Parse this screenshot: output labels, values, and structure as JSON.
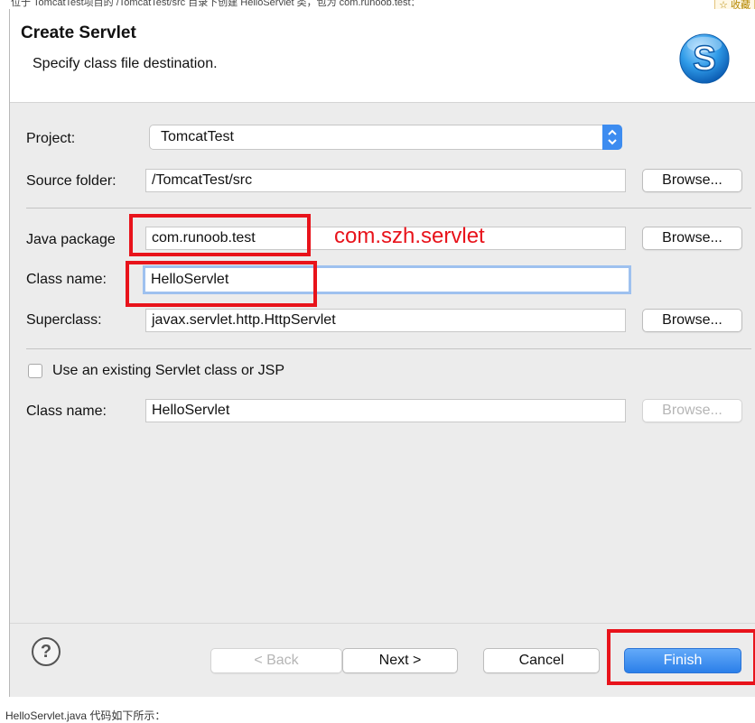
{
  "page": {
    "top_text": "位于 TomcatTest项目的 /TomcatTest/src 目录下创建 HelloServlet 类，包为 com.runoob.test：",
    "top_badge": "☆ 收藏",
    "footer_text": "HelloServlet.java 代码如下所示："
  },
  "dialog": {
    "title": "Create Servlet",
    "subtitle": "Specify class file destination.",
    "logo_icon": "servlet-s-logo-icon"
  },
  "form": {
    "project_label": "Project:",
    "project_value": "TomcatTest",
    "source_folder_label": "Source folder:",
    "source_folder_value": "/TomcatTest/src",
    "java_package_label": "Java package",
    "java_package_value": "com.runoob.test",
    "class_name_label": "Class name:",
    "class_name_value": "HelloServlet",
    "superclass_label": "Superclass:",
    "superclass_value": "javax.servlet.http.HttpServlet",
    "existing_checkbox_label": "Use an existing Servlet class or JSP",
    "existing_checked": false,
    "existing_class_label": "Class name:",
    "existing_class_value": "HelloServlet",
    "browse_label": "Browse..."
  },
  "annotation": {
    "text": "com.szh.servlet",
    "color": "#e8131b"
  },
  "buttons": {
    "help_glyph": "?",
    "back": "< Back",
    "next": "Next >",
    "cancel": "Cancel",
    "finish": "Finish"
  },
  "colors": {
    "accent": "#3d8cf0",
    "highlight": "#e8131b"
  }
}
